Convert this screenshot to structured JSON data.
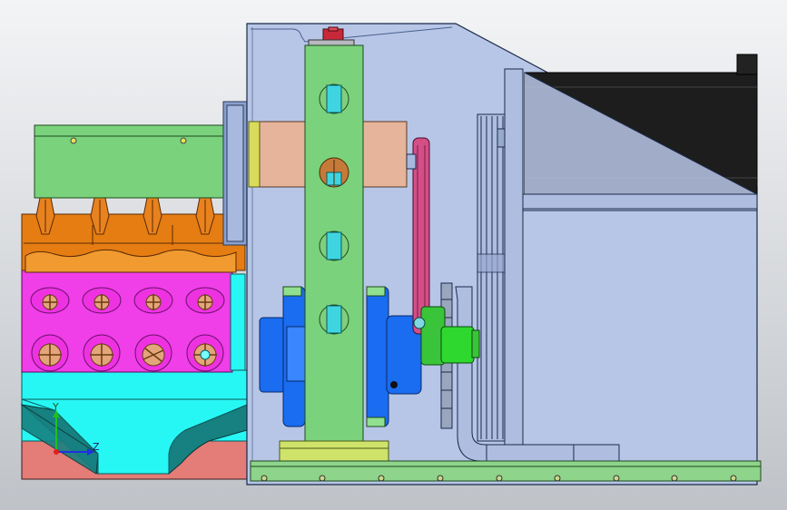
{
  "viewport": {
    "background_top": "#f3f4f6",
    "background_bottom": "#bfc3c8"
  },
  "triad": {
    "y_label": "Y",
    "z_label": "Z",
    "x_axis_color": "#e02020",
    "y_axis_color": "#20c020",
    "z_axis_color": "#2030e0"
  },
  "part_colors": {
    "housing": "#b7c6e6",
    "pink_block": "#e47c78",
    "magenta_block": "#f03ee8",
    "orange_top": "#e57d12",
    "cyan_block": "#27f7f4",
    "teal": "#178080",
    "green_plate": "#7bd27c",
    "tan_bar": "#e6b49a",
    "blue_hub": "#1a6cf0",
    "bright_green": "#2ed82e",
    "dark_motor": "#1d1d1d",
    "belt_pink": "#d34f86",
    "rail_green": "#8ed48a",
    "red_knob": "#c8283a",
    "yellow_base": "#cfe36a"
  }
}
